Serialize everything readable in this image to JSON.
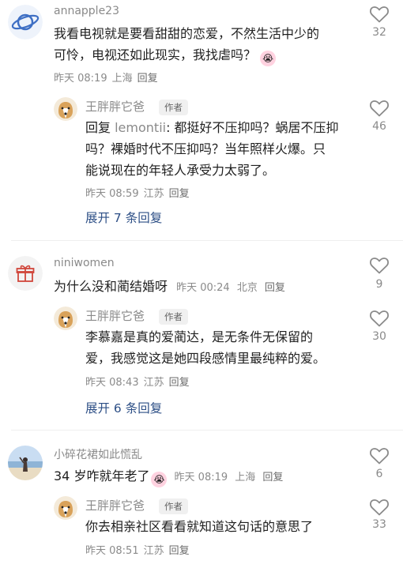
{
  "comments": [
    {
      "user": "annapple23",
      "text_a": "我看电视就是要看甜甜的恋爱，不然生活中少的",
      "text_b": "可怜，电视还如此现实，我找虐吗？",
      "time": "昨天 08:19",
      "location": "上海",
      "reply_label": "回复",
      "likes": "32",
      "replies": [
        {
          "user": "王胖胖它爸",
          "badge": "作者",
          "prefix": "回复",
          "mention": "lemontii",
          "line1": ": 都挺好不压抑吗？蜗居不压抑",
          "line2": "吗？裸婚时代不压抑吗？当年照样火爆。只",
          "line3": "能说现在的年轻人承受力太弱了。",
          "time": "昨天 08:59",
          "location": "江苏",
          "reply_label": "回复",
          "likes": "46"
        }
      ],
      "expand": "展开 7 条回复"
    },
    {
      "user": "niniwomen",
      "text": "为什么没和蔺结婚呀",
      "time": "昨天 00:24",
      "location": "北京",
      "reply_label": "回复",
      "likes": "9",
      "replies": [
        {
          "user": "王胖胖它爸",
          "badge": "作者",
          "line1": "李慕嘉是真的爱蔺达，是无条件无保留的",
          "line2": "爱，我感觉这是她四段感情里最纯粹的爱。",
          "time": "昨天 08:43",
          "location": "江苏",
          "reply_label": "回复",
          "likes": "30"
        }
      ],
      "expand": "展开 6 条回复"
    },
    {
      "user": "小碎花裙如此慌乱",
      "text": "34 岁咋就年老了",
      "time": "昨天 08:19",
      "location": "上海",
      "reply_label": "回复",
      "likes": "6",
      "replies": [
        {
          "user": "王胖胖它爸",
          "badge": "作者",
          "line1": "你去相亲社区看看就知道这句话的意思了",
          "time": "昨天 08:51",
          "location": "江苏",
          "reply_label": "回复",
          "likes": "33"
        }
      ]
    }
  ]
}
